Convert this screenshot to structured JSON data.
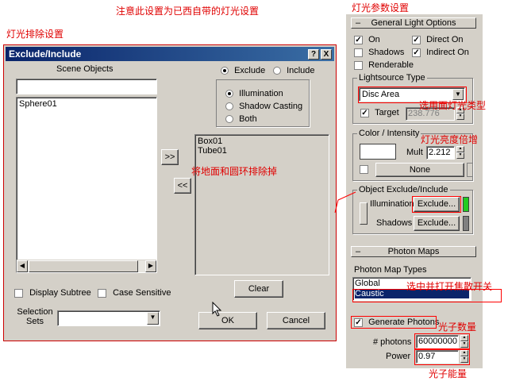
{
  "annotations": {
    "top_note": "注意此设置为已西自带的灯光设置",
    "light_params": "灯光参数设置",
    "exclude_setup": "灯光排除设置",
    "exclude_floor": "将地面和圆环排除掉",
    "select_type": "选用面灯光类型",
    "multiplier": "灯光亮度倍增",
    "caustic_switch": "选中并打开焦散开关",
    "photon_count": "光子数量",
    "photon_energy": "光子能量"
  },
  "dialog": {
    "title": "Exclude/Include",
    "help_btn": "?",
    "close_btn": "X",
    "scene_objects_label": "Scene Objects",
    "search_value": "",
    "scene_list": [
      "Sphere01"
    ],
    "mode_exclude": "Exclude",
    "mode_include": "Include",
    "opt_illumination": "Illumination",
    "opt_shadow": "Shadow Casting",
    "opt_both": "Both",
    "move_right": ">>",
    "move_left": "<<",
    "excluded_list": [
      "Box01",
      "Tube01"
    ],
    "display_subtree": "Display Subtree",
    "case_sensitive": "Case Sensitive",
    "clear": "Clear",
    "selection_sets_1": "Selection",
    "selection_sets_2": "Sets",
    "selection_value": "",
    "ok": "OK",
    "cancel": "Cancel"
  },
  "general": {
    "header": "General Light Options",
    "on": "On",
    "direct_on": "Direct On",
    "shadows": "Shadows",
    "indirect_on": "Indirect On",
    "renderable": "Renderable",
    "lightsource_type_label": "Lightsource Type",
    "lightsource_value": "Disc Area",
    "target": "Target",
    "target_value": "238.776",
    "color_group": "Color / Intensity",
    "mult": "Mult",
    "mult_value": "2.212",
    "none": "None",
    "exclude_group": "Object Exclude/Include",
    "illumination": "Illumination",
    "shadows_label": "Shadows",
    "exclude_btn": "Exclude..."
  },
  "photon": {
    "header": "Photon Maps",
    "types_label": "Photon Map Types",
    "types": [
      "Global",
      "Caustic"
    ],
    "generate": "Generate Photons",
    "photons_label": "# photons",
    "photons_value": "60000000",
    "power_label": "Power",
    "power_value": "0.97"
  },
  "colors": {
    "annotation": "#e00000",
    "title_bar": "#0a246a",
    "selection": "#0a246a",
    "green_swatch": "#22cc22"
  }
}
